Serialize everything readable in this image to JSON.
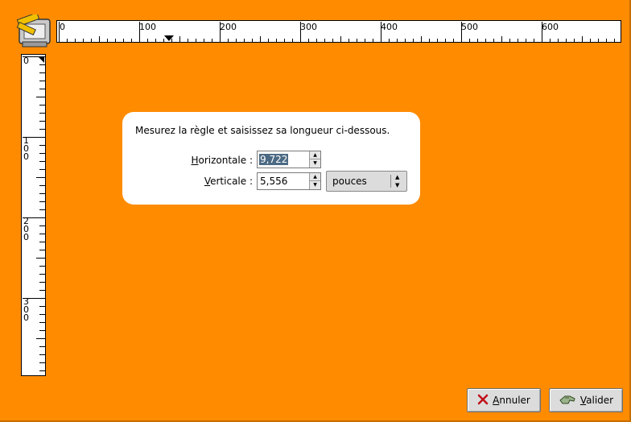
{
  "ruler": {
    "horizontal_labels": [
      "0",
      "100",
      "200",
      "300",
      "400",
      "500",
      "600"
    ],
    "vertical_labels": [
      "0",
      "100",
      "200",
      "300"
    ]
  },
  "panel": {
    "instruction": "Mesurez la règle et saisissez sa longueur ci-dessous.",
    "horizontal": {
      "label": "Horizontale :",
      "mnemonic": "H",
      "rest": "orizontale :",
      "value": "9,722"
    },
    "vertical": {
      "label": "Verticale :",
      "mnemonic": "V",
      "rest": "erticale :",
      "value": "5,556"
    },
    "unit": {
      "selected": "pouces"
    }
  },
  "buttons": {
    "cancel": {
      "mnemonic": "A",
      "rest": "nnuler",
      "icon": "cancel-x-icon"
    },
    "ok": {
      "mnemonic": "V",
      "rest": "alider",
      "icon": "validate-hand-icon"
    }
  },
  "colors": {
    "background": "#ff8c00",
    "selection": "#4b6983",
    "cancel_icon": "#c0101a"
  }
}
